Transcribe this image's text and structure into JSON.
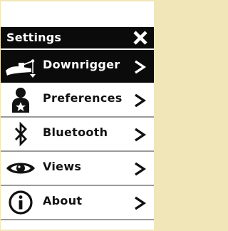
{
  "header": {
    "title": "Settings"
  },
  "menu": [
    {
      "label": "Downrigger",
      "icon": "downrigger-icon",
      "selected": true
    },
    {
      "label": "Preferences",
      "icon": "user-star-icon",
      "selected": false
    },
    {
      "label": "Bluetooth",
      "icon": "bluetooth-icon",
      "selected": false
    },
    {
      "label": "Views",
      "icon": "eye-icon",
      "selected": false
    },
    {
      "label": "About",
      "icon": "info-icon",
      "selected": false
    }
  ],
  "colors": {
    "background": "#f1e6b8",
    "header": "#0b0b0b",
    "selected": "#0b0b0b",
    "divider": "#9a9a9a"
  }
}
